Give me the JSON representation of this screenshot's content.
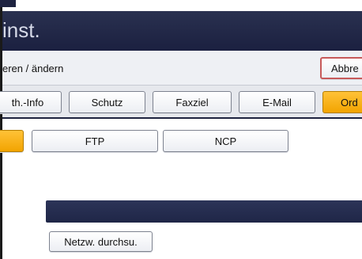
{
  "window": {
    "title": "inst."
  },
  "breadcrumb": "eren / ändern",
  "header": {
    "cancel_label": "Abbre"
  },
  "tabs": [
    {
      "label": "th.-Info",
      "selected": false
    },
    {
      "label": "Schutz",
      "selected": false
    },
    {
      "label": "Faxziel",
      "selected": false
    },
    {
      "label": "E-Mail",
      "selected": false
    },
    {
      "label": "Ord",
      "selected": true
    }
  ],
  "protocols": [
    {
      "label": "",
      "selected": true
    },
    {
      "label": "FTP",
      "selected": false
    },
    {
      "label": "NCP",
      "selected": false
    }
  ],
  "path": {
    "value": ""
  },
  "browse_network_label": "Netzw. durchsu.",
  "colors": {
    "title_bar": "#1b2040",
    "selected_accent": "#f2a400",
    "cancel_border": "#c75a5a"
  }
}
